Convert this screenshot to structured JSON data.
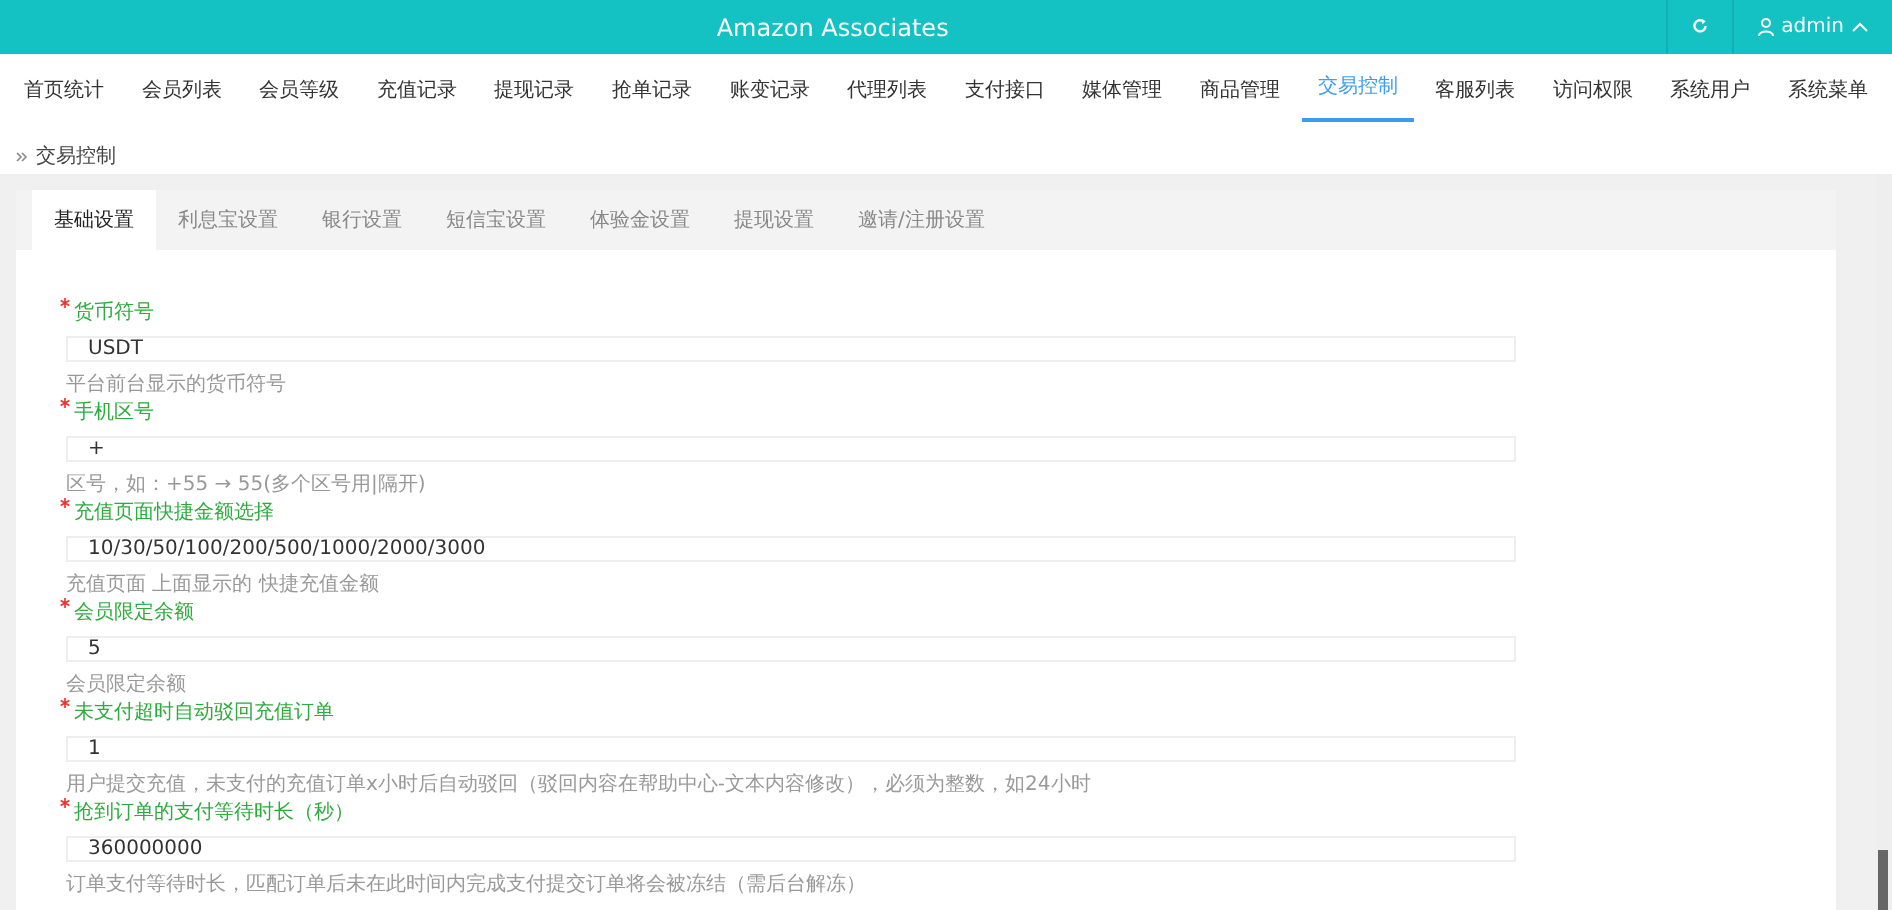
{
  "header": {
    "title": "Amazon Associates",
    "user": "admin"
  },
  "nav": [
    {
      "label": "首页统计",
      "selected": false
    },
    {
      "label": "会员列表",
      "selected": false
    },
    {
      "label": "会员等级",
      "selected": false
    },
    {
      "label": "充值记录",
      "selected": false
    },
    {
      "label": "提现记录",
      "selected": false
    },
    {
      "label": "抢单记录",
      "selected": false
    },
    {
      "label": "账变记录",
      "selected": false
    },
    {
      "label": "代理列表",
      "selected": false
    },
    {
      "label": "支付接口",
      "selected": false
    },
    {
      "label": "媒体管理",
      "selected": false
    },
    {
      "label": "商品管理",
      "selected": false
    },
    {
      "label": "交易控制",
      "selected": true
    },
    {
      "label": "客服列表",
      "selected": false
    },
    {
      "label": "访问权限",
      "selected": false
    },
    {
      "label": "系统用户",
      "selected": false
    },
    {
      "label": "系统菜单",
      "selected": false
    }
  ],
  "breadcrumb": "交易控制",
  "tabs": [
    {
      "label": "基础设置",
      "selected": true
    },
    {
      "label": "利息宝设置",
      "selected": false
    },
    {
      "label": "银行设置",
      "selected": false
    },
    {
      "label": "短信宝设置",
      "selected": false
    },
    {
      "label": "体验金设置",
      "selected": false
    },
    {
      "label": "提现设置",
      "selected": false
    },
    {
      "label": "邀请/注册设置",
      "selected": false
    }
  ],
  "fields": [
    {
      "label": "货币符号",
      "required": true,
      "value": "USDT",
      "hint": "平台前台显示的货币符号"
    },
    {
      "label": "手机区号",
      "required": true,
      "value": "+",
      "hint": "区号，如：+55 → 55(多个区号用|隔开)"
    },
    {
      "label": "充值页面快捷金额选择",
      "required": true,
      "value": "10/30/50/100/200/500/1000/2000/3000",
      "hint": "充值页面 上面显示的 快捷充值金额"
    },
    {
      "label": "会员限定余额",
      "required": true,
      "value": "5",
      "hint": "会员限定余额"
    },
    {
      "label": "未支付超时自动驳回充值订单",
      "required": true,
      "value": "1",
      "hint": "用户提交充值，未支付的充值订单x小时后自动驳回（驳回内容在帮助中心-文本内容修改），必须为整数，如24小时"
    },
    {
      "label": "抢到订单的支付等待时长（秒）",
      "required": true,
      "value": "360000000",
      "hint": "订单支付等待时长，匹配订单后未在此时间内完成支付提交订单将会被冻结（需后台解冻）"
    }
  ]
}
